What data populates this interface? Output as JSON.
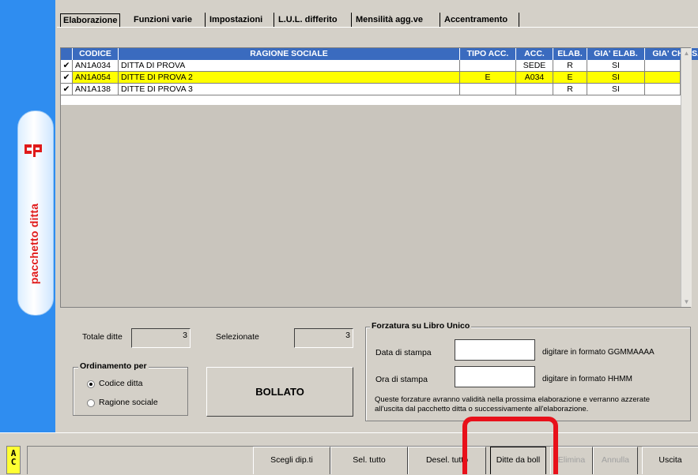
{
  "sidebar": {
    "title": "pacchetto ditta"
  },
  "tabs": [
    "Elaborazione",
    "Funzioni varie",
    "Impostazioni",
    "L.U.L. differito",
    "Mensilità agg.ve",
    "Accentramento"
  ],
  "table": {
    "columns": [
      "CODICE",
      "RAGIONE SOCIALE",
      "TIPO ACC.",
      "ACC.",
      "ELAB.",
      "GIA' ELAB.",
      "GIA' CHIUSA"
    ],
    "rows": [
      {
        "checked": "✔",
        "codice": "AN1A034",
        "ragione": "DITTA DI PROVA",
        "tipo_acc": "",
        "acc": "SEDE",
        "elab": "R",
        "gia_elab": "SI",
        "gia_chiusa": ""
      },
      {
        "checked": "✔",
        "codice": "AN1A054",
        "ragione": "DITTE DI PROVA 2",
        "tipo_acc": "E",
        "acc": "A034",
        "elab": "E",
        "gia_elab": "SI",
        "gia_chiusa": ""
      },
      {
        "checked": "✔",
        "codice": "AN1A138",
        "ragione": "DITTE DI PROVA 3",
        "tipo_acc": "",
        "acc": "",
        "elab": "R",
        "gia_elab": "SI",
        "gia_chiusa": ""
      }
    ],
    "highlight_color": "#ffff00",
    "header_color": "#3a6bbf"
  },
  "totals": {
    "totale_label": "Totale ditte",
    "totale_value": "3",
    "selezionate_label": "Selezionate",
    "selezionate_value": "3"
  },
  "ordinamento": {
    "title": "Ordinamento per",
    "options": [
      "Codice ditta",
      "Ragione sociale"
    ],
    "selected": "Codice ditta"
  },
  "bollato_button": "BOLLATO",
  "forzatura": {
    "title": "Forzatura su Libro Unico",
    "data_label": "Data di stampa",
    "data_value": "",
    "data_hint": "digitare in formato GGMMAAAA",
    "ora_label": "Ora di stampa",
    "ora_value": "",
    "ora_hint": "digitare in formato HHMM",
    "note_line1": "Queste forzature avranno validità nella prossima elaborazione e verranno azzerate",
    "note_line2": "all'uscita dal pacchetto ditta o successivamente all'elaborazione."
  },
  "ac_label_1": "A",
  "ac_label_2": "C",
  "toolbar": {
    "scegli": "Scegli dip.ti",
    "sel_tutto": "Sel. tutto",
    "desel_tutto": "Desel. tutto",
    "ditte_da_boll": "Ditte da boll",
    "elimina": "Elimina",
    "annulla": "Annulla",
    "uscita": "Uscita"
  },
  "colors": {
    "sidebar": "#2f8df0",
    "sidebar_text": "#e01a1a",
    "callout": "#e8101a"
  }
}
